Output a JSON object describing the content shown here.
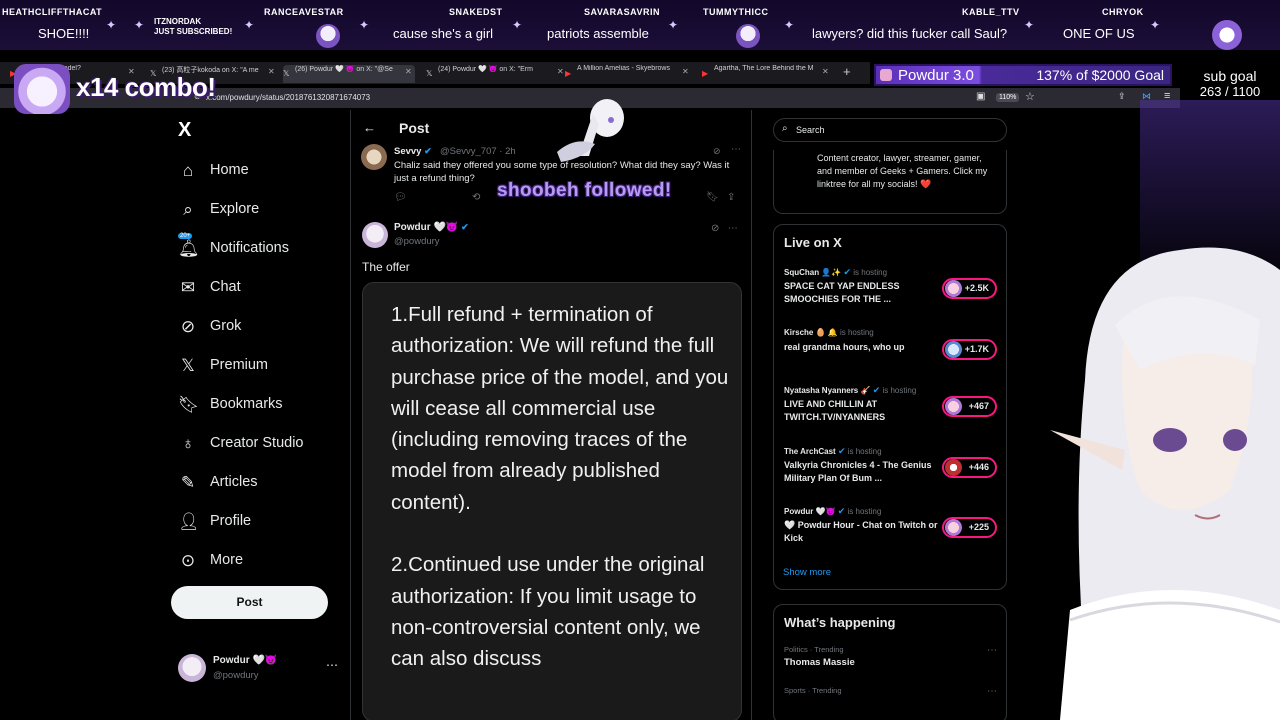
{
  "chat": [
    {
      "name": "HEATHCLIFFTHACAT",
      "text": "SHOE!!!!"
    },
    {
      "name": "ITZNORDAK",
      "text": "JUST SUBSCRIBED!"
    },
    {
      "name": "RANCEAVESTAR",
      "text": "cause she's a girl"
    },
    {
      "name": "SNAKEDST",
      "text": ""
    },
    {
      "name": "SAVARASAVRIN",
      "text": "patriots assemble"
    },
    {
      "name": "TUMMYTHICC",
      "text": ""
    },
    {
      "name": "KABLE_TTV",
      "text": "lawyers? did this fucker call Saul?"
    },
    {
      "name": "CHRYOK",
      "text": "ONE OF US"
    }
  ],
  "overlay": {
    "combo": "x14 combo!",
    "goal_name": "Powdur 3.0",
    "goal_progress": "137% of $2000 Goal",
    "subgoal_label": "sub goal",
    "subgoal_count": "263 / 1100",
    "follow_alert": "shoobeh followed!"
  },
  "browser": {
    "tabs": [
      {
        "label": "My VTuber Model?",
        "active": false
      },
      {
        "label": "(23) 高粒子kokoda on X: \"A me",
        "active": false
      },
      {
        "label": "(26) Powdur 🤍 😈 on X: \"@Se",
        "active": true
      },
      {
        "label": "(24) Powdur 🤍 😈 on X: \"Erm",
        "active": false
      },
      {
        "label": "A Million Amelias - Skyebrows",
        "active": false
      },
      {
        "label": "Agartha, The Lore Behind the M",
        "active": false
      }
    ],
    "url": "x.com/powdury/status/2018761320871674073",
    "zoom": "110%"
  },
  "nav": {
    "logo": "X",
    "items": [
      {
        "label": "Home",
        "icon": "home-icon"
      },
      {
        "label": "Explore",
        "icon": "search-icon"
      },
      {
        "label": "Notifications",
        "icon": "bell-icon",
        "badge": "20+"
      },
      {
        "label": "Chat",
        "icon": "mail-icon"
      },
      {
        "label": "Grok",
        "icon": "grok-icon"
      },
      {
        "label": "Premium",
        "icon": "x-icon"
      },
      {
        "label": "Bookmarks",
        "icon": "bookmark-icon"
      },
      {
        "label": "Creator Studio",
        "icon": "flask-icon"
      },
      {
        "label": "Articles",
        "icon": "article-icon"
      },
      {
        "label": "Profile",
        "icon": "person-icon"
      },
      {
        "label": "More",
        "icon": "more-icon"
      }
    ],
    "post_button": "Post",
    "account_name": "Powdur 🤍😈",
    "account_handle": "@powdury"
  },
  "main": {
    "header": "Post",
    "reply": {
      "name": "Sevvy",
      "handle": "@Sevvy_707 · 2h",
      "text": "Chaliz said they offered you some type of resolution? What did they say? Was it just a refund thing?"
    },
    "op": {
      "name": "Powdur 🤍😈",
      "handle": "@powdury",
      "text": "The offer"
    },
    "offer_image_text": "1.Full refund + termination of authorization: We will refund the full purchase price of the model, and you will cease all commercial use (including removing traces of the model from      already published content).\n\n2.Continued use under the original authorization: If you limit usage to non-controversial content only, we can also discuss"
  },
  "right": {
    "search_placeholder": "Search",
    "bio": "Content creator, lawyer, streamer, gamer, and member of Geeks + Gamers. Click my linktree for all my socials! ❤️",
    "live_title": "Live on X",
    "live": [
      {
        "host": "SquChan 👤✨",
        "title": "SPACE CAT YAP ENDLESS SMOOCHIES FOR THE ...",
        "count": "+2.5K"
      },
      {
        "host": "Kirsche 🥚 🔔",
        "title": "real grandma hours, who up",
        "count": "+1.7K"
      },
      {
        "host": "Nyatasha Nyanners 🎸",
        "title": "LIVE AND CHILLIN AT TWITCH.TV/NYANNERS",
        "count": "+467"
      },
      {
        "host": "The ArchCast",
        "title": "Valkyria Chronicles 4 - The Genius Military Plan Of Bum ...",
        "count": "+446"
      },
      {
        "host": "Powdur 🤍😈",
        "title": "🤍 Powdur Hour - Chat on Twitch or Kick",
        "count": "+225"
      }
    ],
    "hosting_label": "is hosting",
    "show_more": "Show more",
    "happening_title": "What’s happening",
    "trends": [
      {
        "meta": "Politics · Trending",
        "name": "Thomas Massie"
      },
      {
        "meta": "Sports · Trending",
        "name": ""
      }
    ]
  }
}
